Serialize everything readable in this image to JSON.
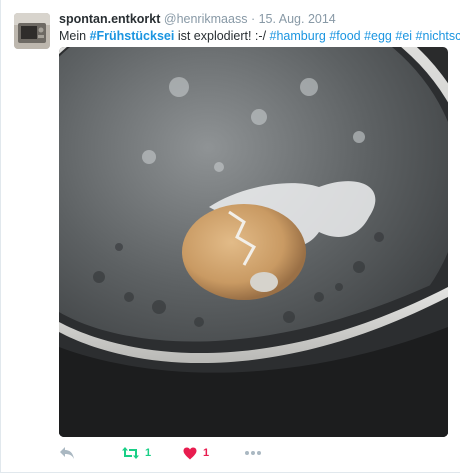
{
  "user": {
    "display_name": "spontan.entkorkt",
    "handle": "@henrikmaass",
    "separator": "·",
    "date": "15. Aug. 2014"
  },
  "tweet": {
    "text_prefix": "Mein ",
    "hashtag_bold": "#Frühstücksei",
    "text_middle": " ist explodiert! :-/ ",
    "hashtags": [
      "#hamburg",
      "#food",
      "#egg",
      "#ei",
      "#nichtschön"
    ]
  },
  "media": {
    "description": "photo"
  },
  "actions": {
    "retweet_count": "1",
    "like_count": "1"
  },
  "colors": {
    "link": "#1b95e0",
    "retweet": "#19cf86",
    "like": "#e81c4f",
    "muted": "#8899a6"
  },
  "icons": [
    "reply-icon",
    "retweet-icon",
    "heart-icon",
    "more-icon"
  ]
}
